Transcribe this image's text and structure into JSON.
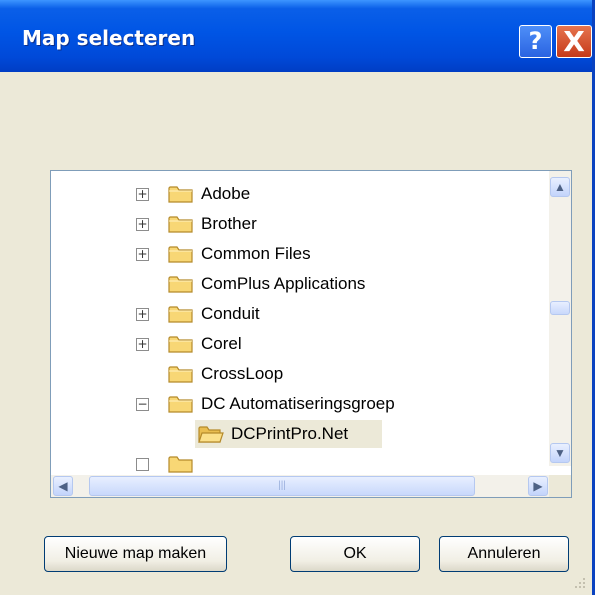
{
  "window": {
    "title": "Map selecteren"
  },
  "titlebar": {
    "help_glyph": "?",
    "close_glyph": "X"
  },
  "tree": {
    "items": [
      {
        "label": "Adobe",
        "expander": "+"
      },
      {
        "label": "Brother",
        "expander": "+"
      },
      {
        "label": "Common Files",
        "expander": "+"
      },
      {
        "label": "ComPlus Applications",
        "expander": ""
      },
      {
        "label": "Conduit",
        "expander": "+"
      },
      {
        "label": "Corel",
        "expander": "+"
      },
      {
        "label": "CrossLoop",
        "expander": ""
      },
      {
        "label": "DC Automatiseringsgroep",
        "expander": "−"
      },
      {
        "label": "DCPrintPro.Net",
        "expander": "",
        "selected": true,
        "open_folder": true
      }
    ]
  },
  "buttons": {
    "new_folder": "Nieuwe map maken",
    "ok": "OK",
    "cancel": "Annuleren"
  },
  "colors": {
    "titlebar": "#0055e5",
    "window": "#ece9d8",
    "close": "#c5391a"
  },
  "icons": {
    "help": "question-mark-icon",
    "close": "close-icon",
    "folder": "folder-icon"
  }
}
